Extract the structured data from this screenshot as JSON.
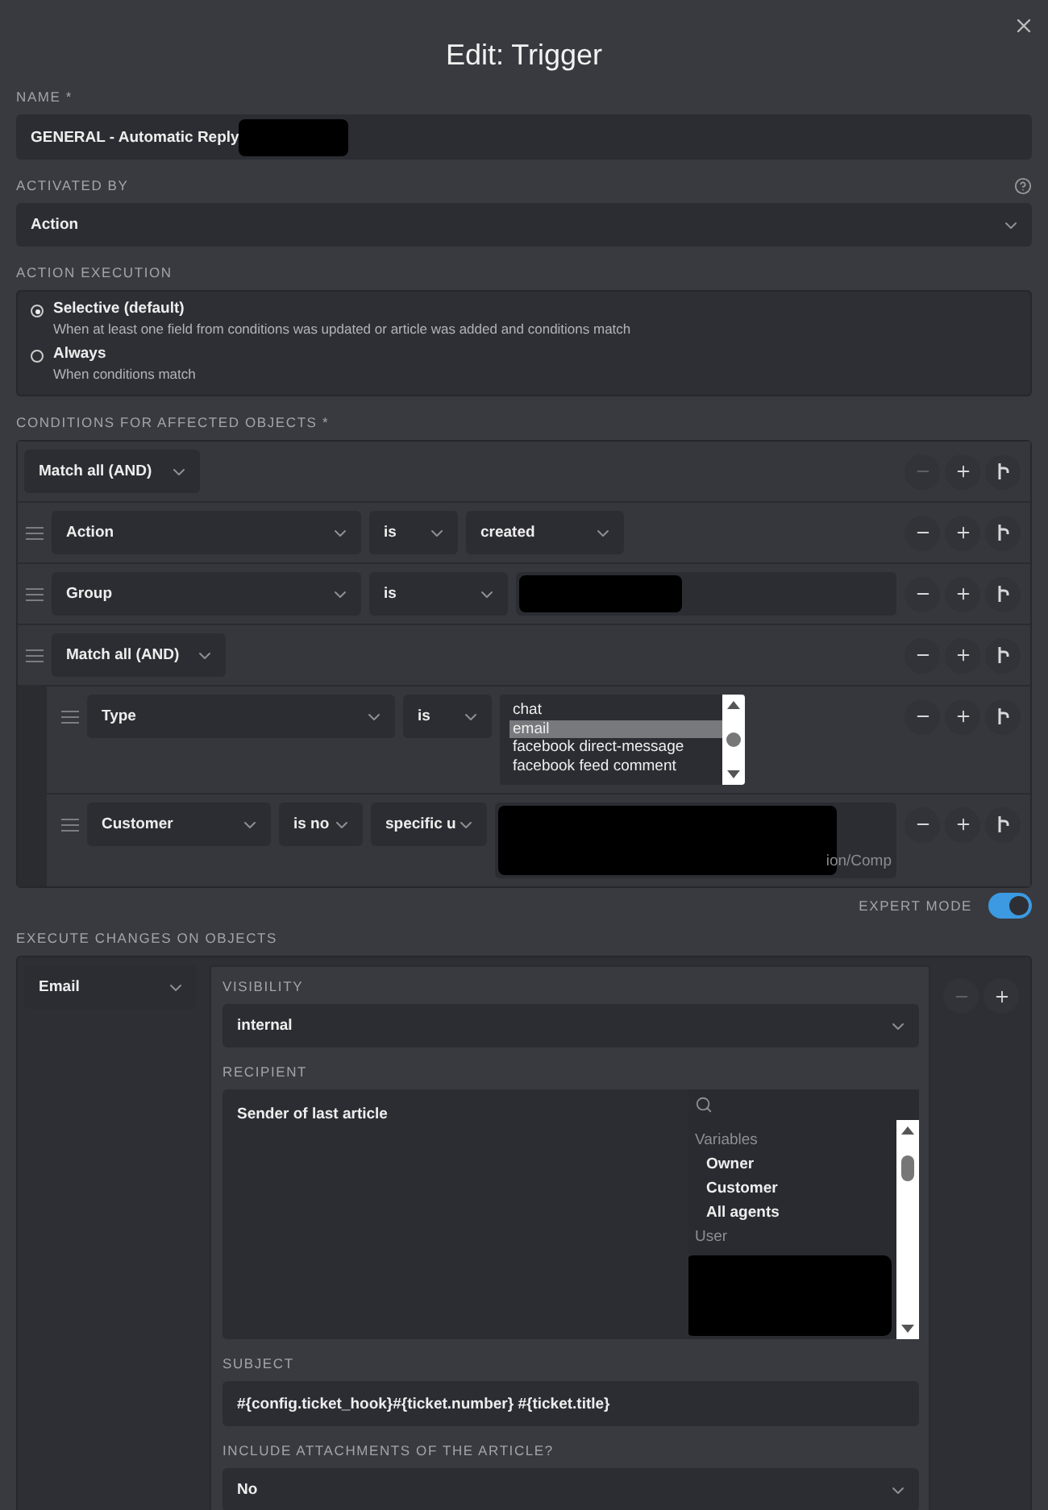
{
  "dialog": {
    "title": "Edit: Trigger"
  },
  "name": {
    "label": "NAME *",
    "value": "GENERAL - Automatic Reply",
    "redacted": true
  },
  "activated_by": {
    "label": "ACTIVATED BY",
    "value": "Action"
  },
  "action_execution": {
    "label": "ACTION EXECUTION",
    "options": [
      {
        "title": "Selective (default)",
        "description": "When at least one field from conditions was updated or article was added and conditions match",
        "selected": true
      },
      {
        "title": "Always",
        "description": "When conditions match",
        "selected": false
      }
    ]
  },
  "conditions": {
    "label": "CONDITIONS FOR AFFECTED OBJECTS *",
    "match": "Match all (AND)",
    "remove_disabled": true,
    "children": [
      {
        "kind": "rule",
        "attribute": "Action",
        "operator": "is",
        "value": "created"
      },
      {
        "kind": "rule",
        "attribute": "Group",
        "operator": "is",
        "field": {
          "redacted": true
        }
      },
      {
        "kind": "group",
        "match": "Match all (AND)",
        "children": [
          {
            "kind": "rule",
            "attribute": "Type",
            "operator": "is",
            "listbox": [
              {
                "label": "chat",
                "selected": false
              },
              {
                "label": "email",
                "selected": true
              },
              {
                "label": "facebook direct-message",
                "selected": false
              },
              {
                "label": "facebook feed comment",
                "selected": false
              }
            ]
          },
          {
            "kind": "rule",
            "attribute": "Customer",
            "operator": "is no",
            "value": "specific u",
            "field": {
              "redacted": true,
              "hint": "ion/Comp"
            }
          }
        ]
      }
    ]
  },
  "expert_mode": {
    "label": "EXPERT MODE",
    "on": true
  },
  "execute": {
    "label": "EXECUTE CHANGES ON OBJECTS",
    "object": "Email",
    "remove_disabled": true,
    "fields": [
      {
        "kind": "select",
        "label": "VISIBILITY",
        "value": "internal"
      },
      {
        "kind": "recipient",
        "label": "RECIPIENT",
        "value": "Sender of last article",
        "redacted": true,
        "list": [
          {
            "kind": "heading",
            "label": "Variables"
          },
          {
            "kind": "item",
            "label": "Owner"
          },
          {
            "kind": "item",
            "label": "Customer"
          },
          {
            "kind": "item",
            "label": "All agents"
          },
          {
            "kind": "heading",
            "label": "User"
          }
        ]
      },
      {
        "kind": "input",
        "label": "SUBJECT",
        "value": "#{config.ticket_hook}#{ticket.number} #{ticket.title}"
      },
      {
        "kind": "select",
        "label": "INCLUDE ATTACHMENTS OF THE ARTICLE?",
        "value": "No"
      }
    ]
  }
}
